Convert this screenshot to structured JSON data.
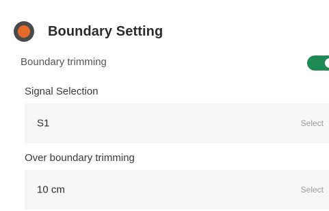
{
  "header": {
    "title": "Boundary Setting",
    "icon": "record-dot-icon",
    "icon_color": "#e56a2a"
  },
  "boundary_trimming": {
    "label": "Boundary trimming",
    "enabled": true,
    "toggle_color": "#1f8a55"
  },
  "signal_selection": {
    "label": "Signal Selection",
    "value": "S1",
    "action": "Select"
  },
  "over_boundary_trimming": {
    "label": "Over boundary trimming",
    "value": "10 cm",
    "action": "Select"
  }
}
